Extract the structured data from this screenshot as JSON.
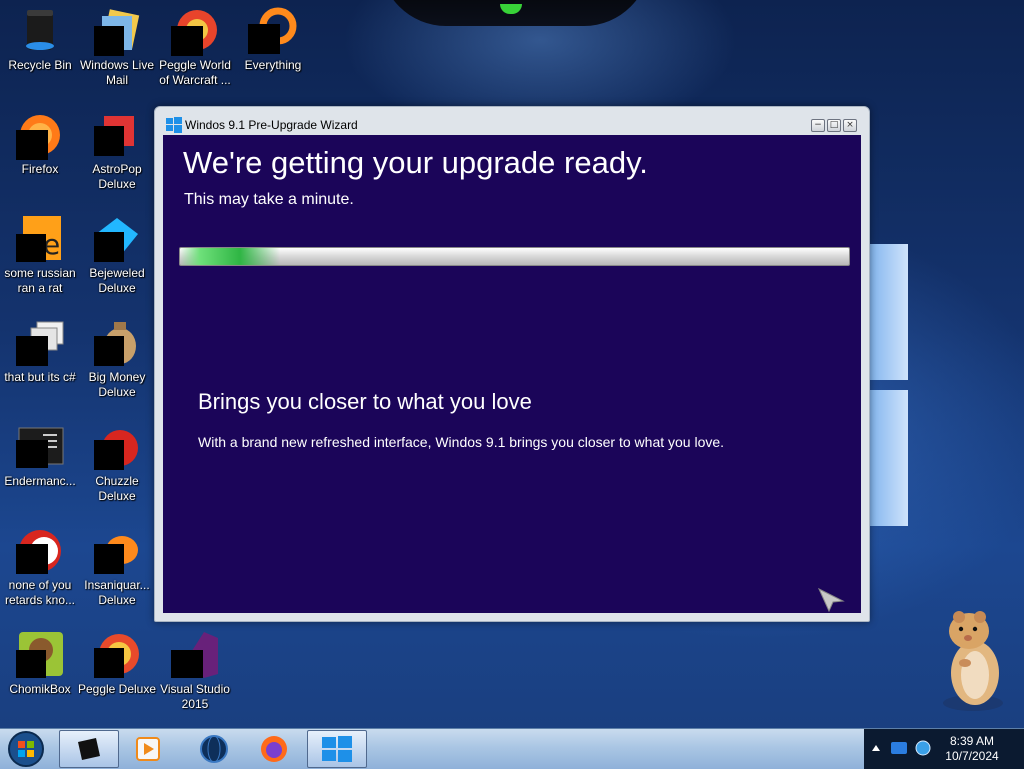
{
  "desktop": {
    "icons": [
      {
        "label": "Recycle Bin",
        "icon": "recycle-bin-icon"
      },
      {
        "label": "Windows Live Mail",
        "icon": "windows-live-mail-icon"
      },
      {
        "label": "Peggle World of Warcraft ...",
        "icon": "peggle-icon"
      },
      {
        "label": "Everything",
        "icon": "everything-search-icon"
      },
      {
        "label": "Firefox",
        "icon": "firefox-icon"
      },
      {
        "label": "AstroPop Deluxe",
        "icon": "astropop-icon"
      },
      {
        "label": "some russian ran a rat",
        "icon": "java-file-icon"
      },
      {
        "label": "Bejeweled Deluxe",
        "icon": "bejeweled-icon"
      },
      {
        "label": "that but its c#",
        "icon": "stacked-windows-icon"
      },
      {
        "label": "Big Money Deluxe",
        "icon": "big-money-icon"
      },
      {
        "label": "Endermanc...",
        "icon": "terminal-app-icon"
      },
      {
        "label": "Chuzzle Deluxe",
        "icon": "chuzzle-icon"
      },
      {
        "label": "none of you retards kno...",
        "icon": "red-circle-app-icon"
      },
      {
        "label": "Insaniquar... Deluxe",
        "icon": "insaniquarium-icon"
      },
      {
        "label": "ChomikBox",
        "icon": "chomikbox-icon"
      },
      {
        "label": "Peggle Deluxe",
        "icon": "peggle-deluxe-icon"
      },
      {
        "label": "Visual Studio 2015",
        "icon": "visual-studio-icon"
      }
    ]
  },
  "wizard": {
    "title": "Windos 9.1 Pre-Upgrade Wizard",
    "heading": "We're getting your upgrade ready.",
    "subheading": "This may take a minute.",
    "progress_fraction": 0.15,
    "promo_title": "Brings you closer to what you love",
    "promo_body": "With a brand new refreshed interface, Windos 9.1 brings you closer to what you love.",
    "controls": [
      "minimize",
      "maximize",
      "close"
    ]
  },
  "taskbar": {
    "start_icon": "start-orb-icon",
    "items": [
      {
        "name": "terminal-app",
        "icon": "terminal-app-icon",
        "active": true
      },
      {
        "name": "media-player",
        "icon": "media-player-icon",
        "active": false
      },
      {
        "name": "globe-app",
        "icon": "globe-icon",
        "active": false
      },
      {
        "name": "firefox",
        "icon": "firefox-icon",
        "active": false
      },
      {
        "name": "upgrade-wizard",
        "icon": "windows-logo-icon",
        "active": true
      }
    ],
    "tray": {
      "time": "8:39 AM",
      "date": "10/7/2024",
      "icons": [
        "show-hidden-icons-icon",
        "action-center-icon",
        "network-globe-icon"
      ]
    }
  },
  "colors": {
    "wizard_background": "#1b0559",
    "progress_green": "#2fb544",
    "taskbar": "#aac6e4"
  }
}
